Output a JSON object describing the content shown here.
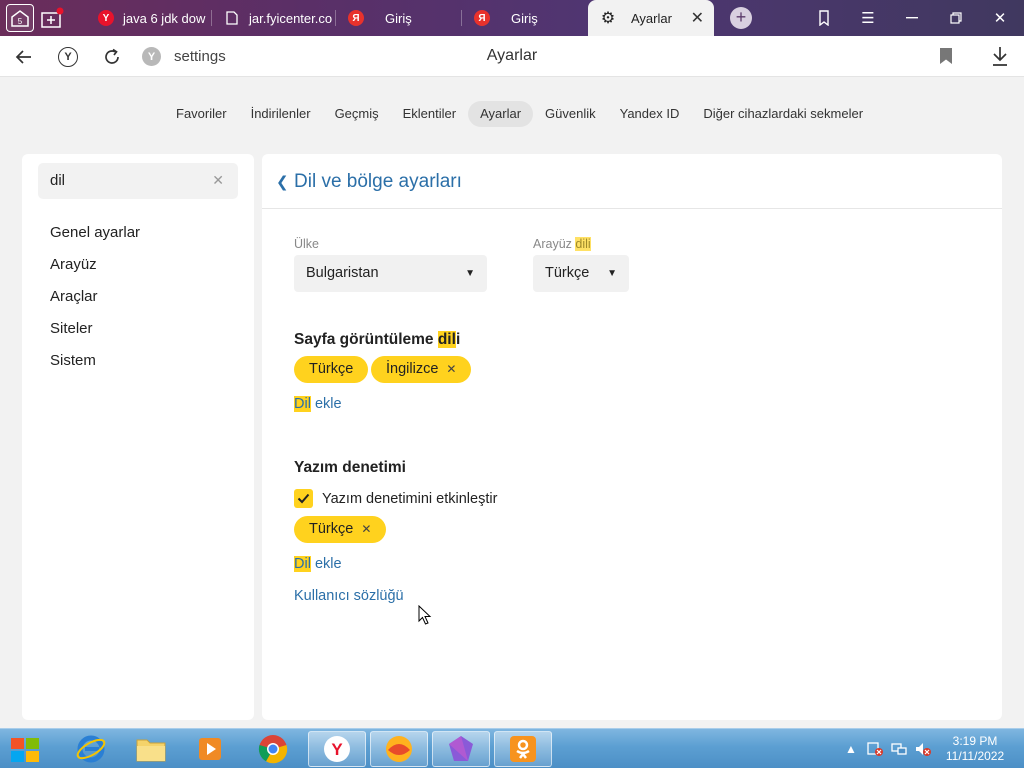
{
  "tabs": [
    {
      "title": "java 6 jdk dow",
      "favicon": "yandex-y-icon",
      "color": "#e8132c"
    },
    {
      "title": "jar.fyicenter.co",
      "favicon": "page-icon",
      "color": "#ffffff"
    },
    {
      "title": "Giriş",
      "favicon": "yandex-ya-icon",
      "color": "#e8322c"
    },
    {
      "title": "Giriş",
      "favicon": "yandex-ya-icon",
      "color": "#e8322c"
    },
    {
      "title": "Ayarlar",
      "favicon": "gear-icon",
      "active": true
    }
  ],
  "address": {
    "url": "settings",
    "page_name": "Ayarlar"
  },
  "topnav": [
    {
      "label": "Favoriler"
    },
    {
      "label": "İndirilenler"
    },
    {
      "label": "Geçmiş"
    },
    {
      "label": "Eklentiler"
    },
    {
      "label": "Ayarlar",
      "active": true
    },
    {
      "label": "Güvenlik"
    },
    {
      "label": "Yandex ID"
    },
    {
      "label": "Diğer cihazlardaki sekmeler"
    }
  ],
  "sidebar": {
    "search_value": "dil",
    "items": [
      {
        "label": "Genel ayarlar"
      },
      {
        "label": "Arayüz"
      },
      {
        "label": "Araçlar"
      },
      {
        "label": "Siteler"
      },
      {
        "label": "Sistem"
      }
    ]
  },
  "panel": {
    "title": "Dil ve bölge ayarları",
    "country": {
      "label": "Ülke",
      "value": "Bulgaristan"
    },
    "ui_lang": {
      "label_pre": "Arayüz ",
      "label_hl": "dili",
      "value": "Türkçe"
    },
    "page_lang": {
      "title_pre": "Sayfa görüntüleme ",
      "title_hl": "dil",
      "title_post": "i",
      "chips": [
        {
          "label": "Türkçe"
        },
        {
          "label": "İngilizce",
          "removable": true
        }
      ],
      "add_hl": "Dil",
      "add_rest": " ekle"
    },
    "spell": {
      "title": "Yazım denetimi",
      "checkbox_label": "Yazım denetimini etkinleştir",
      "checked": true,
      "chips": [
        {
          "label": "Türkçe",
          "removable": true
        }
      ],
      "add_hl": "Dil",
      "add_rest": " ekle",
      "dict_link": "Kullanıcı sözlüğü"
    }
  },
  "taskbar": {
    "time": "3:19 PM",
    "date": "11/11/2022"
  },
  "colors": {
    "accent_link": "#2b6fa8",
    "highlight": "#ffd21e"
  }
}
